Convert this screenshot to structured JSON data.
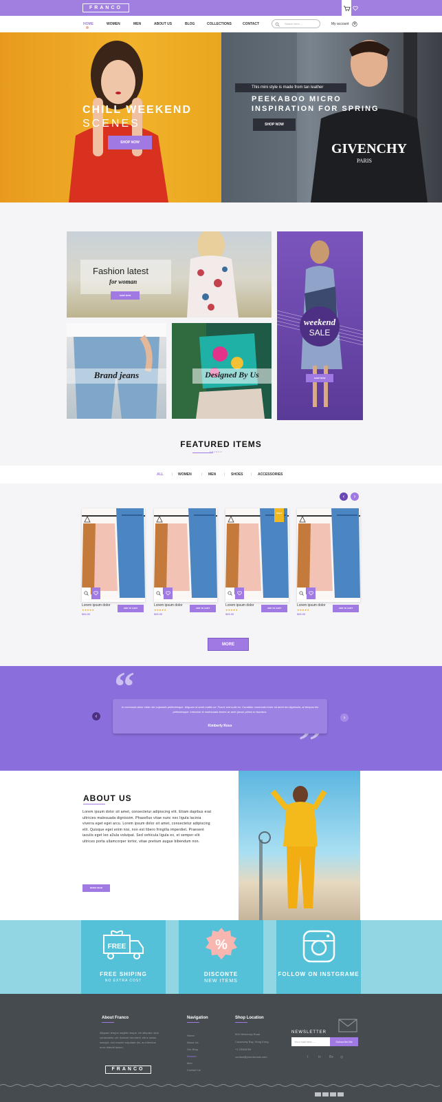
{
  "brand": "FRANCO",
  "nav": {
    "items": [
      "HOME",
      "WOMEN",
      "MEN",
      "ABOUT US",
      "BLOG",
      "COLLECTIONS",
      "CONTACT"
    ],
    "search_placeholder": "Search here.....",
    "account": "My account"
  },
  "hero": {
    "left_line1": "CHILL WEEKEND",
    "left_line2": "SCENES",
    "left_button": "SHOP NOW",
    "right_tag": "This mini style is made from tan leather",
    "right_line1": "PEEKABOO MICRO",
    "right_line2": "INSPIRATION FOR SPRING",
    "right_button": "SHOP NOW",
    "shirt_text": "GIVENCHY",
    "shirt_sub": "PARIS"
  },
  "promos": {
    "fashion_title": "Fashion latest",
    "fashion_sub": "for woman",
    "fashion_button": "SHOP NOW",
    "weekend_title": "weekend",
    "weekend_sub": "SALE",
    "weekend_button": "SHOP NOW",
    "jeans_title": "Brand jeans",
    "designed_title": "Designed By Us"
  },
  "featured": {
    "title": "FEATURED ITEMS",
    "subtitle": "FRANCO",
    "tabs": [
      "ALL",
      "WOMEN",
      "MEN",
      "SHOES",
      "ACCESSORIES"
    ],
    "products": [
      {
        "name": "Lorem ipsum dolor",
        "price": "$66.00",
        "button": "ADD TO CART",
        "rating": "★★★★★",
        "badge": ""
      },
      {
        "name": "Lorem ipsum dolor",
        "price": "$66.00",
        "button": "ADD TO CART",
        "rating": "★★★★★",
        "badge": ""
      },
      {
        "name": "Lorem ipsum dolor",
        "price": "$66.00",
        "button": "ADD TO CART",
        "rating": "★★★★★",
        "badge": "SALE"
      },
      {
        "name": "Lorem ipsum dolor",
        "price": "$66.00",
        "button": "ADD TO CART",
        "rating": "★★★★★",
        "badge": ""
      }
    ],
    "more_button": "MORE"
  },
  "testimonial": {
    "text": "In commodo dolor vitae nisi vulputate pellentesque. Aliquam id amet mattis mi. Fusce sed nulla ex. Curabitur commodo tortor sit amet leo dignissim, at tempus leo pellentesque. Interdum et malesuada fames ac ante ipsum primis in faucibus.",
    "author": "Kimberly Ross"
  },
  "about": {
    "title": "ABOUT US",
    "body": "Lorem ipsum dolor sit amet, consectetur adipiscing elit. Etiam dapibus erat ultricies malesuada dignissim. Phasellus vitae nunc nec ligula lacinia viverra eget eget arcu. Lorem ipsum dolor sit amet, consectetur adipiscing elit. Quisque eget enim nisi, non est libero fringilla imperdiet. Praesent iaculis eget leo a3ula volutpat. Sed vehicula ligula ex, et semper elit ultrices porta ullamcorper tortor, vitae pretium augue bibendum non.",
    "button": "MORE READ"
  },
  "features": [
    {
      "title": "FREE SHIPING",
      "sub": "NO EXTRA COST",
      "icon": "truck-icon",
      "icon_text": "FREE"
    },
    {
      "title": "DISCONTE",
      "sub": "NEW ITEMS",
      "icon": "percent-icon",
      "icon_text": "%"
    },
    {
      "title": "FOLLOW ON INSTGRAME",
      "sub": "",
      "icon": "instagram-icon",
      "icon_text": ""
    }
  ],
  "footer": {
    "about_title": "About Franco",
    "about_text": "Aliquam tempor sagittis neque, vel aliquam risus consectetur vel. Aenean hendrerit, elit a varius suscipit, orci mauris vulputate dui, ac interdum nunc diamat ipsum.",
    "logo": "FRANCO",
    "nav_title": "Navigation",
    "nav_links": [
      "Home",
      "About Us",
      "Our Blog",
      "Women",
      "Men",
      "Contact Us"
    ],
    "shop_title": "Shop Location",
    "shop_lines": [
      "500 Hennessy Road",
      "Causeway Bay, Hong Kong",
      "+1 23456789",
      "contact@yourdomain.com"
    ],
    "newsletter_title": "NEWSLETTER",
    "newsletter_placeholder": "Your mail here.....",
    "newsletter_button": "Subscribe Me"
  },
  "colors": {
    "accent": "#a07ae2",
    "testimonial_bg": "#8a6fdc",
    "feature_bg": "#55c1d8",
    "footer_bg": "#464b50"
  }
}
